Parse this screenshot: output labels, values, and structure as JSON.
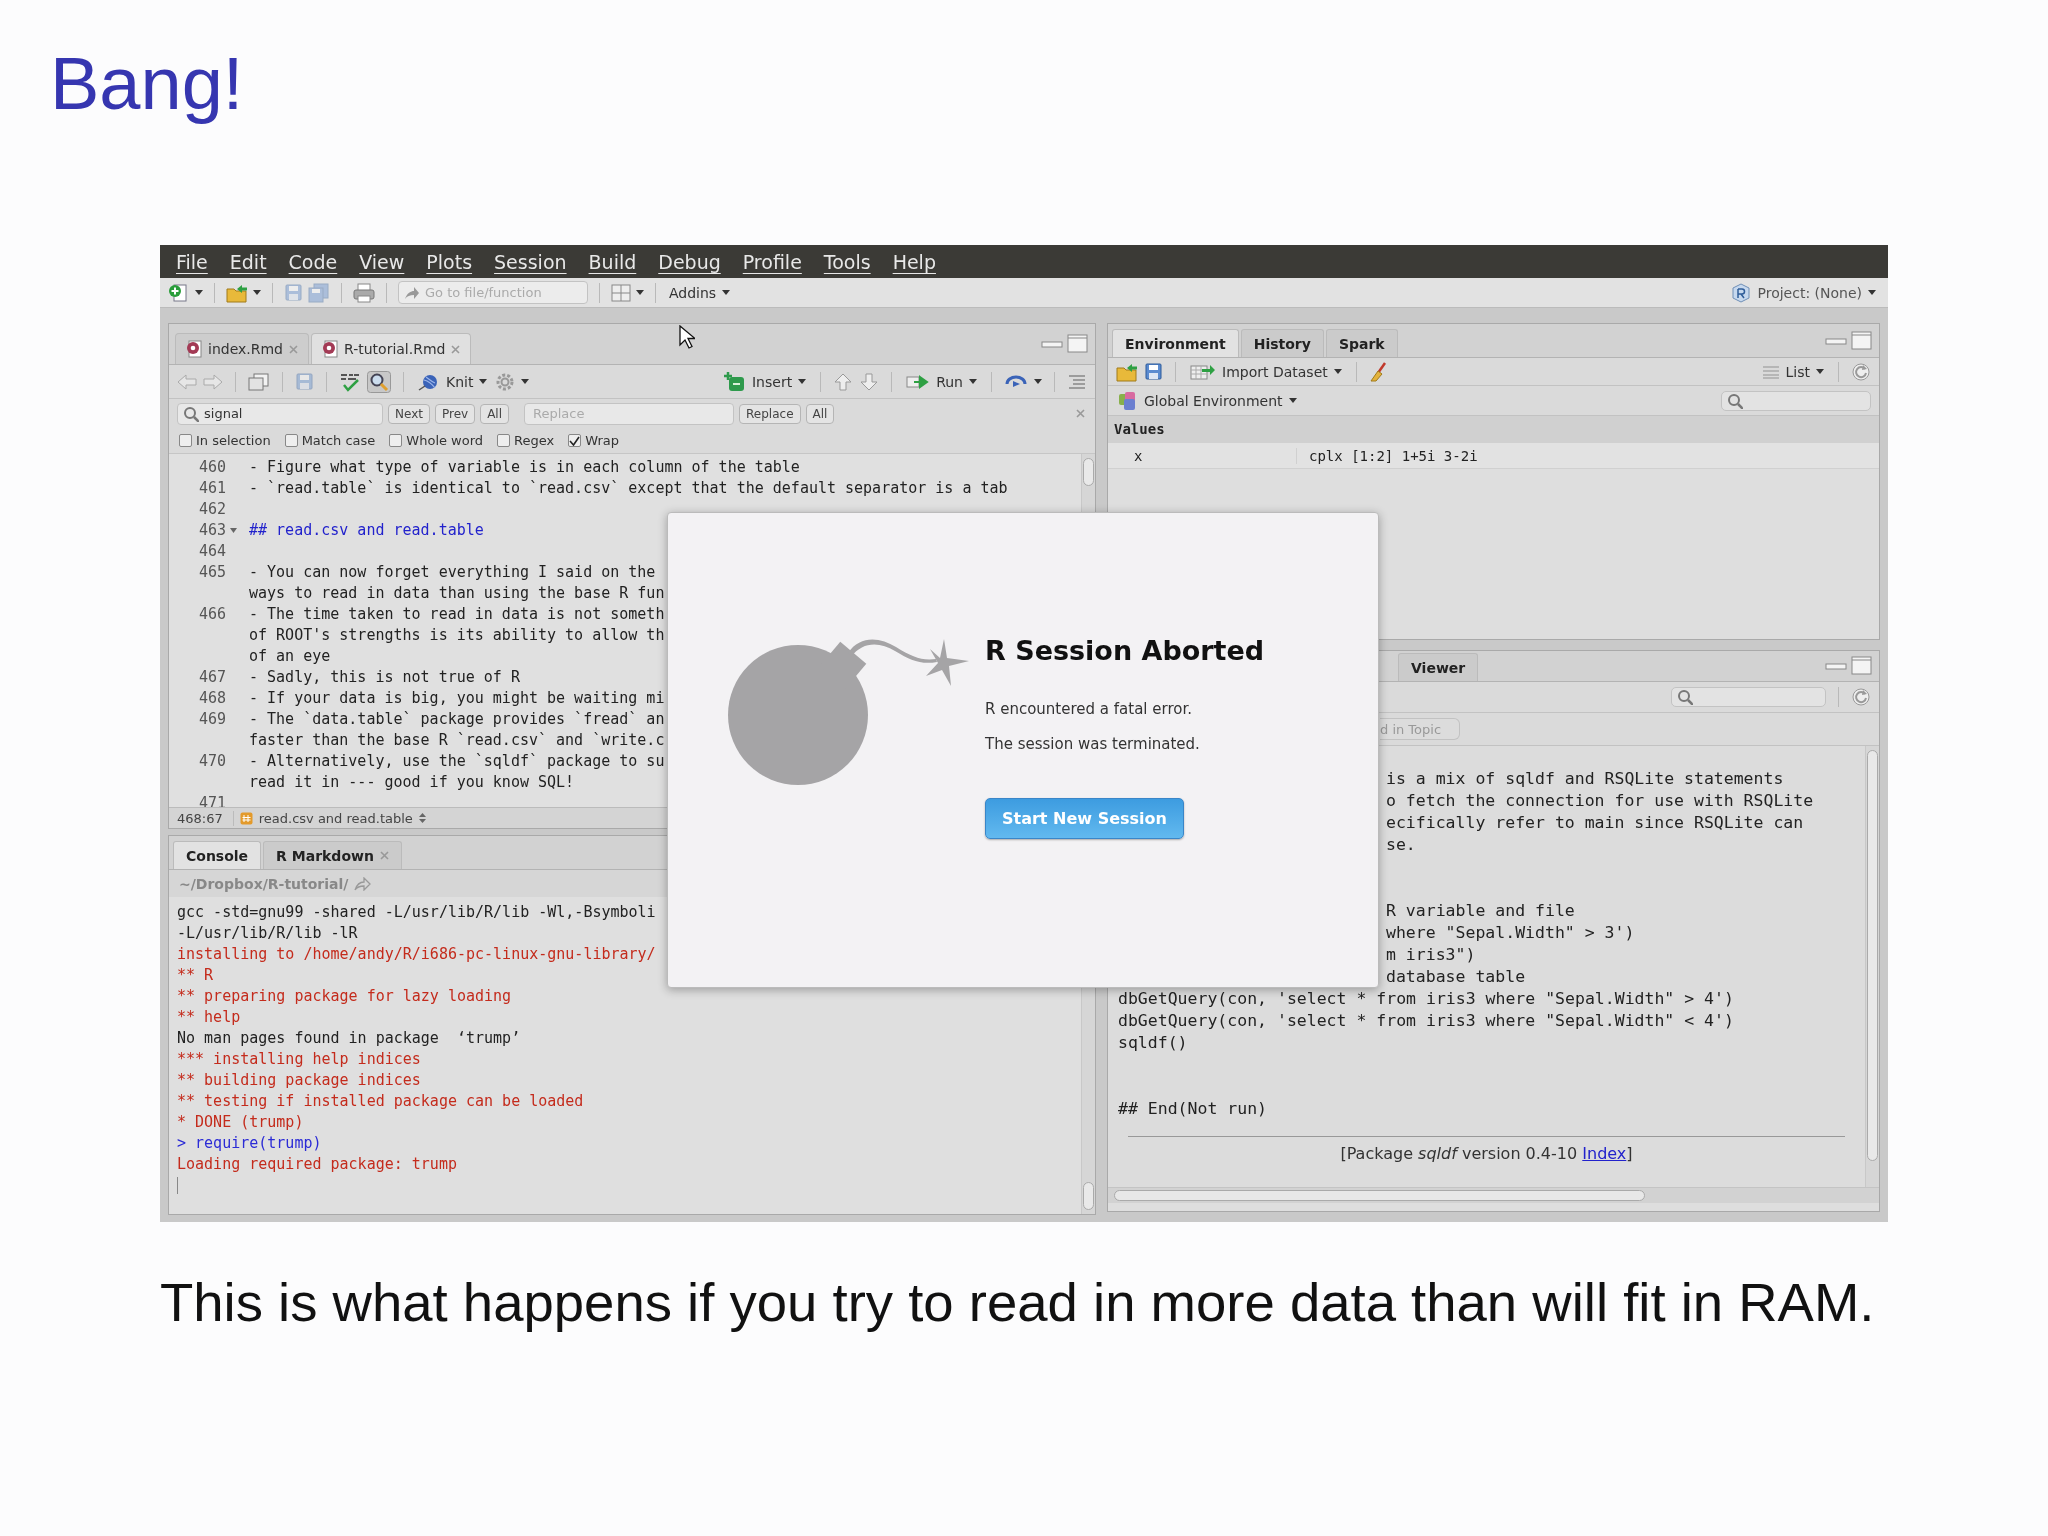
{
  "slide": {
    "title": "Bang!",
    "caption": "This is what happens if you try to read in more data than will fit in RAM."
  },
  "menu": [
    "File",
    "Edit",
    "Code",
    "View",
    "Plots",
    "Session",
    "Build",
    "Debug",
    "Profile",
    "Tools",
    "Help"
  ],
  "toolbar": {
    "goto_placeholder": "Go to file/function",
    "addins": "Addins",
    "project": "Project: (None)"
  },
  "editor": {
    "tabs": [
      {
        "label": "index.Rmd",
        "selected": false
      },
      {
        "label": "R-tutorial.Rmd",
        "selected": true
      }
    ],
    "tools": {
      "knit": "Knit",
      "insert": "Insert",
      "run": "Run"
    },
    "find": {
      "value": "signal",
      "next": "Next",
      "prev": "Prev",
      "all": "All",
      "replace_placeholder": "Replace",
      "replace": "Replace",
      "replace_all": "All"
    },
    "options": [
      {
        "label": "In selection",
        "checked": false
      },
      {
        "label": "Match case",
        "checked": false
      },
      {
        "label": "Whole word",
        "checked": false
      },
      {
        "label": "Regex",
        "checked": false
      },
      {
        "label": "Wrap",
        "checked": true
      }
    ],
    "lines": [
      {
        "number": "460",
        "kind": "text",
        "rows": [
          "- Figure what type of variable is in each column of the table"
        ]
      },
      {
        "number": "461",
        "kind": "text",
        "rows": [
          "- `read.table` is identical to `read.csv` except that the default separator is a tab"
        ]
      },
      {
        "number": "462",
        "kind": "text"
      },
      {
        "number": "463",
        "kind": "heading",
        "rows": [
          "## read.csv and read.table"
        ]
      },
      {
        "number": "464",
        "kind": "text"
      },
      {
        "number": "465",
        "kind": "text",
        "rows": [
          "- You can now forget everything I said on the",
          "ways to read in data than using the base R fun"
        ]
      },
      {
        "number": "466",
        "kind": "text",
        "rows": [
          "- The time taken to read in data is not someth",
          "of ROOT's strengths is its ability to allow th",
          "of an eye"
        ]
      },
      {
        "number": "467",
        "kind": "text",
        "rows": [
          "- Sadly, this is not true of R"
        ]
      },
      {
        "number": "468",
        "kind": "text",
        "rows": [
          "- If your data is big, you might be waiting mi"
        ]
      },
      {
        "number": "469",
        "kind": "text",
        "rows": [
          "- The `data.table` package provides `fread` an",
          "faster than the base R `read.csv` and `write.c"
        ]
      },
      {
        "number": "470",
        "kind": "text",
        "rows": [
          "- Alternatively, use the `sqldf` package to su",
          "read it in --- good if you know SQL!"
        ]
      },
      {
        "number": "471",
        "kind": "text"
      }
    ],
    "status": {
      "position": "468:67",
      "section": "read.csv and read.table"
    }
  },
  "console": {
    "tabs": [
      {
        "label": "Console",
        "selected": true,
        "closable": false
      },
      {
        "label": "R Markdown",
        "selected": false,
        "closable": true
      }
    ],
    "path": "~/Dropbox/R-tutorial/",
    "lines": [
      {
        "kind": "output",
        "text": "gcc -std=gnu99 -shared -L/usr/lib/R/lib -Wl,-Bsymboli"
      },
      {
        "kind": "output",
        "text": "-L/usr/lib/R/lib -lR"
      },
      {
        "kind": "message",
        "text": "installing to /home/andy/R/i686-pc-linux-gnu-library/"
      },
      {
        "kind": "message",
        "text": "** R"
      },
      {
        "kind": "message",
        "text": "** preparing package for lazy loading"
      },
      {
        "kind": "message",
        "text": "** help"
      },
      {
        "kind": "output",
        "text": "No man pages found in package  ‘trump’"
      },
      {
        "kind": "message",
        "text": "*** installing help indices"
      },
      {
        "kind": "message",
        "text": "** building package indices"
      },
      {
        "kind": "message",
        "text": "** testing if installed package can be loaded"
      },
      {
        "kind": "message",
        "text": "* DONE (trump)"
      },
      {
        "kind": "input",
        "text": "> require(trump)"
      },
      {
        "kind": "message",
        "text": "Loading required package: trump"
      }
    ]
  },
  "environment": {
    "tabs": [
      {
        "label": "Environment",
        "selected": true
      },
      {
        "label": "History",
        "selected": false
      },
      {
        "label": "Spark",
        "selected": false
      }
    ],
    "import": "Import Dataset",
    "view": "List",
    "scope": "Global Environment",
    "section": "Values",
    "rows": [
      {
        "name": "x",
        "value": "cplx [1:2] 1+5i 3-2i"
      }
    ]
  },
  "help": {
    "tabs": [
      {
        "label": "Viewer",
        "selected": false
      }
    ],
    "find_button": "d in Topic",
    "blocks": [
      [
        {
          "kind": "clipped",
          "text": "is a mix of sqldf and RSQLite statements"
        },
        {
          "kind": "clipped",
          "text": "o fetch the connection for use with RSQLite"
        },
        {
          "kind": "clipped",
          "text": "ecifically refer to main since RSQLite can"
        },
        {
          "kind": "clipped",
          "text": "se."
        }
      ],
      [
        {
          "kind": "clipped",
          "text": "R variable and file"
        },
        {
          "kind": "clipped",
          "text": "where \"Sepal.Width\" > 3')"
        },
        {
          "kind": "clipped",
          "text": "m iris3\")"
        },
        {
          "kind": "clipped",
          "text": "database table"
        },
        {
          "kind": "full",
          "text": "dbGetQuery(con, 'select * from iris3 where \"Sepal.Width\" > 4')"
        },
        {
          "kind": "full",
          "text": "dbGetQuery(con, 'select * from iris3 where \"Sepal.Width\" < 4')"
        },
        {
          "kind": "full",
          "text": "sqldf()"
        }
      ],
      [
        {
          "kind": "full",
          "text": "## End(Not run)"
        }
      ]
    ],
    "footer": {
      "text": "[Package *sqldf* version 0.4-10 ",
      "link": "Index",
      "end": "]"
    }
  },
  "dialog": {
    "title": "R Session Aborted",
    "messages": [
      "R encountered a fatal error.",
      "The session was terminated."
    ],
    "button": "Start New Session"
  }
}
